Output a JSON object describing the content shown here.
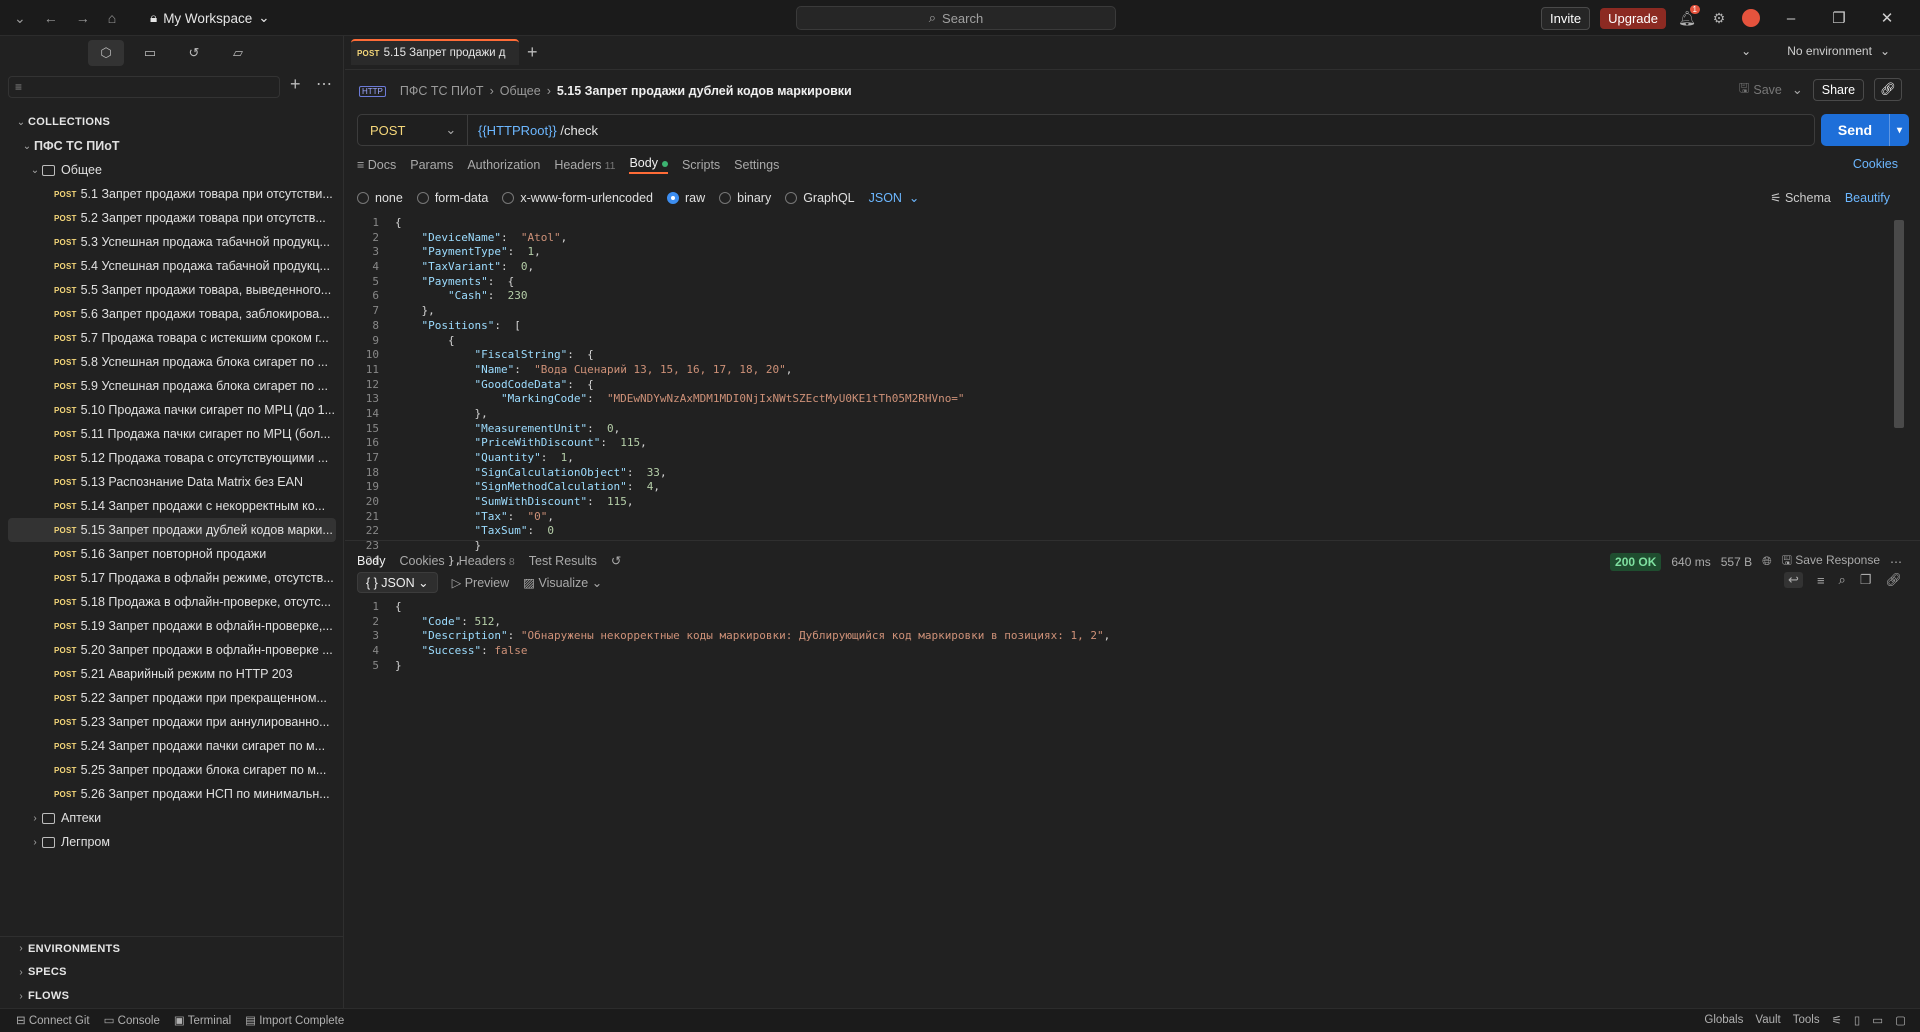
{
  "titlebar": {
    "workspace": "My Workspace",
    "search_placeholder": "Search",
    "invite": "Invite",
    "upgrade": "Upgrade",
    "notif_count": "1"
  },
  "sidebar": {
    "collections_header": "COLLECTIONS",
    "collection": "ПФС ТС ПИоТ",
    "folder_open": "Общее",
    "method": "POST",
    "requests": [
      "5.1 Запрет продажи товара при отсутстви...",
      "5.2 Запрет продажи товара при отсутств...",
      "5.3 Успешная продажа табачной продукц...",
      "5.4 Успешная продажа табачной продукц...",
      "5.5 Запрет продажи товара, выведенного...",
      "5.6 Запрет продажи товара, заблокирова...",
      "5.7 Продажа товара с истекшим сроком г...",
      "5.8 Успешная продажа блока сигарет по ...",
      "5.9 Успешная продажа блока сигарет по ...",
      "5.10 Продажа пачки сигарет по МРЦ (до 1...",
      "5.11 Продажа пачки сигарет по МРЦ (бол...",
      "5.12 Продажа товара с отсутствующими ...",
      "5.13 Распознание Data Matrix без EAN",
      "5.14 Запрет продажи с некорректным ко...",
      "5.15 Запрет продажи дублей кодов марки...",
      "5.16 Запрет повторной продажи",
      "5.17 Продажа в офлайн режиме, отсутств...",
      "5.18 Продажа в офлайн-проверке, отсутс...",
      "5.19 Запрет продажи в офлайн-проверке,...",
      "5.20 Запрет продажи в офлайн-проверке ...",
      "5.21 Аварийный режим по HTTP 203",
      "5.22 Запрет продажи при прекращенном...",
      "5.23 Запрет продажи при аннулированно...",
      "5.24 Запрет продажи пачки сигарет по м...",
      "5.25 Запрет продажи блока сигарет по м...",
      "5.26 Запрет продажи НСП по минимальн..."
    ],
    "folders_closed": [
      "Аптеки",
      "Легпром"
    ],
    "bottom": [
      "ENVIRONMENTS",
      "SPECS",
      "FLOWS"
    ]
  },
  "tab": {
    "method": "POST",
    "label": "5.15 Запрет продажи д"
  },
  "env": "No environment",
  "breadcrumb": {
    "http": "HTTP",
    "a": "ПФС ТС ПИоТ",
    "b": "Общее",
    "current": "5.15 Запрет продажи дублей кодов маркировки"
  },
  "actions": {
    "save": "Save",
    "share": "Share"
  },
  "request": {
    "method": "POST",
    "url_var": "{{HTTPRoot}}",
    "url_path": " /check",
    "send": "Send"
  },
  "reqtabs": {
    "docs": "Docs",
    "params": "Params",
    "auth": "Authorization",
    "headers": "Headers",
    "headers_count": "11",
    "body": "Body",
    "scripts": "Scripts",
    "settings": "Settings",
    "cookies": "Cookies"
  },
  "bodymodes": {
    "none": "none",
    "form": "form-data",
    "urlenc": "x-www-form-urlencoded",
    "raw": "raw",
    "binary": "binary",
    "graphql": "GraphQL",
    "json": "JSON",
    "schema": "Schema",
    "beautify": "Beautify"
  },
  "request_body": [
    "{",
    "    \"DeviceName\":  \"Atol\",",
    "    \"PaymentType\":  1,",
    "    \"TaxVariant\":  0,",
    "    \"Payments\":  {",
    "        \"Cash\":  230",
    "    },",
    "    \"Positions\":  [",
    "        {",
    "            \"FiscalString\":  {",
    "            \"Name\":  \"Вода Сценарий 13, 15, 16, 17, 18, 20\",",
    "            \"GoodCodeData\":  {",
    "                \"MarkingCode\":  \"MDEwNDYwNzAxMDM1MDI0NjIxNWtSZEctMyU0KE1tTh05M2RHVno=\"",
    "            },",
    "            \"MeasurementUnit\":  0,",
    "            \"PriceWithDiscount\":  115,",
    "            \"Quantity\":  1,",
    "            \"SignCalculationObject\":  33,",
    "            \"SignMethodCalculation\":  4,",
    "            \"SumWithDiscount\":  115,",
    "            \"Tax\":  \"0\",",
    "            \"TaxSum\":  0",
    "            }",
    "        },"
  ],
  "response": {
    "tabs": {
      "body": "Body",
      "cookies": "Cookies",
      "headers": "Headers",
      "headers_count": "8",
      "tests": "Test Results"
    },
    "status": "200 OK",
    "time": "640 ms",
    "size": "557 B",
    "save": "Save Response",
    "mode": "{ } JSON",
    "preview": "Preview",
    "visualize": "Visualize",
    "lines": [
      "{",
      "    \"Code\": 512,",
      "    \"Description\": \"Обнаружены некорректные коды маркировки: Дублирующийся код маркировки в позициях: 1, 2\",",
      "    \"Success\": false",
      "}"
    ]
  },
  "footer": {
    "git": "Connect Git",
    "console": "Console",
    "terminal": "Terminal",
    "import": "Import Complete",
    "globals": "Globals",
    "vault": "Vault",
    "tools": "Tools"
  }
}
